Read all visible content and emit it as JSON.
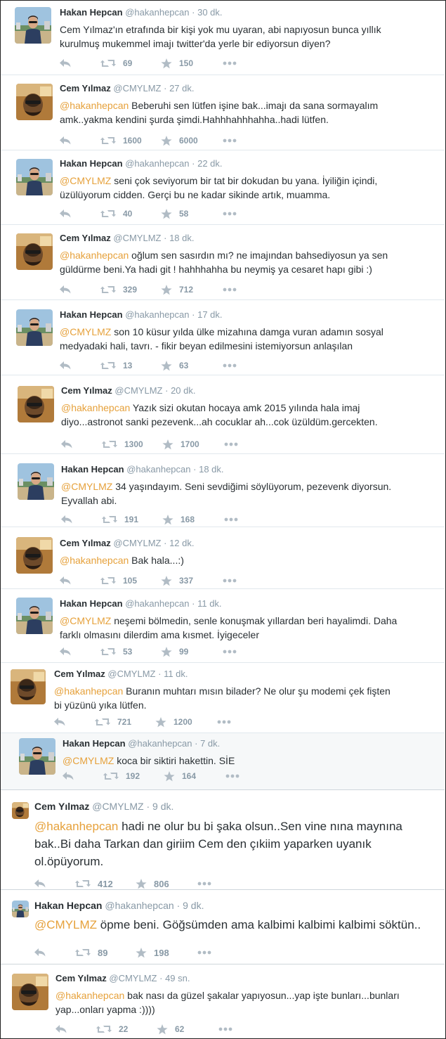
{
  "users": {
    "hakan": {
      "name": "Hakan Hepcan",
      "handle": "@hakanhepcan"
    },
    "cem": {
      "name": "Cem Yılmaz",
      "handle": "@CMYLMZ"
    }
  },
  "dot": "·",
  "icons": {
    "reply": "reply-icon",
    "retweet": "retweet-icon",
    "favorite": "star-icon",
    "more": "more-icon"
  },
  "colors": {
    "mention": "#e6a13b",
    "meta": "#8899a6",
    "text": "#292f33"
  },
  "tweets": [
    {
      "user": "hakan",
      "time": "30 dk.",
      "mention": "",
      "text": "Cem Yılmaz'ın etrafında bir kişi yok mu uyaran, abi napıyosun bunca yıllık\nkurulmuş mukemmel imajı twitter'da yerle bir ediyorsun diyen?",
      "retweets": "69",
      "favorites": "150"
    },
    {
      "user": "cem",
      "time": "27 dk.",
      "mention": "@hakanhepcan",
      "text": " Beberuhi sen lütfen işine bak...imajı da sana sormayalım\namk..yakma kendini şurda şimdi.Hahhhahhhahha..hadi lütfen.",
      "retweets": "1600",
      "favorites": "6000"
    },
    {
      "user": "hakan",
      "time": "22 dk.",
      "mention": "@CMYLMZ",
      "text": " seni çok seviyorum bir tat bir dokudan bu yana. İyiliğin içindi,\nüzülüyorum cidden. Gerçi bu ne kadar sikinde artık, muamma.",
      "retweets": "40",
      "favorites": "58"
    },
    {
      "user": "cem",
      "time": "18 dk.",
      "mention": "@hakanhepcan",
      "text": " oğlum sen sasırdın mı? ne imajından bahsediyosun ya sen\ngüldürme beni.Ya hadi git ! hahhhahha bu neymiş ya cesaret hapı gibi :)",
      "retweets": "329",
      "favorites": "712"
    },
    {
      "user": "hakan",
      "time": "17 dk.",
      "mention": "@CMYLMZ",
      "text": " son 10 küsur yılda ülke mizahına damga vuran adamın sosyal\nmedyadaki hali, tavrı. - fikir beyan edilmesini istemiyorsun anlaşılan",
      "retweets": "13",
      "favorites": "63"
    },
    {
      "user": "cem",
      "time": "20 dk.",
      "mention": "@hakanhepcan",
      "text": " Yazık sizi okutan hocaya amk 2015 yılında hala imaj\ndiyo...astronot sanki pezevenk...ah cocuklar ah...cok üzüldüm.gercekten.",
      "retweets": "1300",
      "favorites": "1700"
    },
    {
      "user": "hakan",
      "time": "18 dk.",
      "mention": "@CMYLMZ",
      "text": " 34 yaşındayım. Seni sevdiğimi söylüyorum, pezevenk diyorsun.\nEyvallah abi.",
      "retweets": "191",
      "favorites": "168"
    },
    {
      "user": "cem",
      "time": "12 dk.",
      "mention": "@hakanhepcan",
      "text": " Bak hala...:)",
      "retweets": "105",
      "favorites": "337"
    },
    {
      "user": "hakan",
      "time": "11 dk.",
      "mention": "@CMYLMZ",
      "text": " neşemi bölmedin, senle konuşmak yıllardan beri hayalimdi. Daha\nfarklı olmasını dilerdim ama kısmet. İyigeceler",
      "retweets": "53",
      "favorites": "99"
    },
    {
      "user": "cem",
      "time": "11 dk.",
      "mention": "@hakanhepcan",
      "text": " Buranın muhtarı mısın bilader? Ne olur şu modemi çek fişten\nbi yüzünü yıka lütfen.",
      "retweets": "721",
      "favorites": "1200"
    },
    {
      "user": "hakan",
      "time": "7 dk.",
      "mention": "@CMYLMZ",
      "text": " koca bir siktiri hakettin. SİE",
      "retweets": "192",
      "favorites": "164"
    },
    {
      "user": "cem",
      "time": "9 dk.",
      "mention": "@hakanhepcan",
      "text": " hadi ne olur bu bi şaka olsun..Sen vine nına maynına\nbak..Bi daha Tarkan dan giriim Cem den çıkiim yaparken uyanık\nol.öpüyorum.",
      "retweets": "412",
      "favorites": "806"
    },
    {
      "user": "hakan",
      "time": "9 dk.",
      "mention": "@CMYLMZ",
      "text": " öpme beni. Göğsümden ama kalbimi kalbimi kalbimi söktün..",
      "retweets": "89",
      "favorites": "198"
    },
    {
      "user": "cem",
      "time": "49 sn.",
      "mention": "@hakanhepcan",
      "text": " bak nası da güzel şakalar yapıyosun...yap işte bunları...bunları\nyap...onları yapma :))))",
      "retweets": "22",
      "favorites": "62"
    }
  ]
}
